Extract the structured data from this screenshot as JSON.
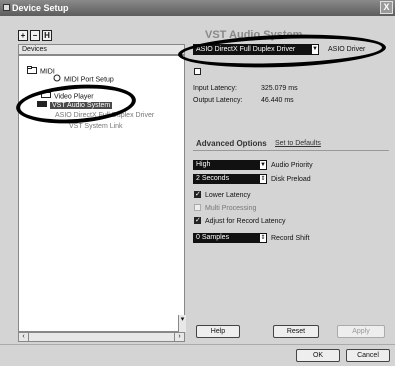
{
  "window": {
    "title": "Device Setup",
    "close_glyph": "X"
  },
  "toolbar": {
    "add_label": "+",
    "remove_label": "−",
    "reset_label": "H"
  },
  "devices": {
    "header": "Devices",
    "items": [
      {
        "label": "MIDI"
      },
      {
        "label": "MIDI Port Setup"
      },
      {
        "label": "Video Player"
      },
      {
        "label": "VST Audio System"
      },
      {
        "label": "ASIO DirectX Full Duplex Driver"
      },
      {
        "label": "VST System Link"
      }
    ]
  },
  "panel": {
    "title": "VST Audio System",
    "driver_value": "ASIO DirectX Full Duplex Driver",
    "driver_label": "ASIO Driver",
    "input_latency_label": "Input Latency:",
    "input_latency_value": "325.079 ms",
    "output_latency_label": "Output Latency:",
    "output_latency_value": "46.440 ms",
    "advanced_title": "Advanced Options",
    "set_defaults": "Set to Defaults",
    "audio_priority_value": "High",
    "audio_priority_label": "Audio Priority",
    "disk_preload_value": "2 Seconds",
    "disk_preload_label": "Disk Preload",
    "lower_latency_label": "Lower Latency",
    "lower_latency_checked": true,
    "multi_processing_label": "Multi Processing",
    "multi_processing_checked": false,
    "adjust_record_label": "Adjust for Record Latency",
    "adjust_record_checked": true,
    "record_shift_value": "0 Samples",
    "record_shift_label": "Record Shift"
  },
  "buttons": {
    "help": "Help",
    "reset": "Reset",
    "apply": "Apply",
    "ok": "OK",
    "cancel": "Cancel"
  }
}
